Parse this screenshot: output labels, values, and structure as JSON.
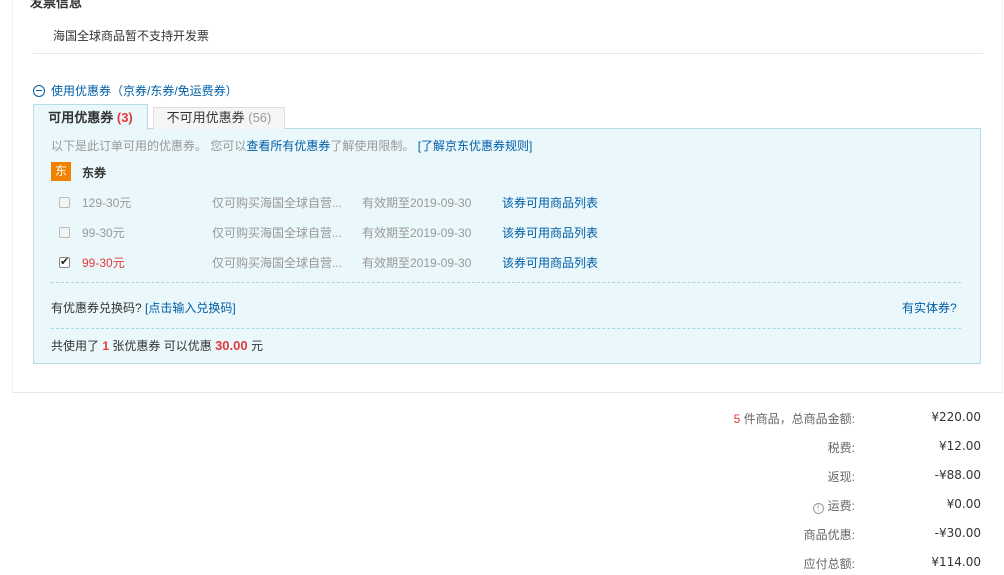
{
  "invoice": {
    "title": "发票信息",
    "note": "海国全球商品暂不支持开发票"
  },
  "coupon": {
    "toggle_label": "使用优惠券（京券/东券/免运费券）",
    "tabs": [
      {
        "label": "可用优惠券",
        "count": "(3)"
      },
      {
        "label": "不可用优惠券",
        "count": "(56)"
      }
    ],
    "intro_prefix": "以下是此订单可用的优惠券。 您可以",
    "intro_link": "查看所有优惠券",
    "intro_mid": "了解使用限制。",
    "intro_rules_link": "[了解京东优惠券规则]",
    "group_badge": "东",
    "group_label": "东券",
    "items": [
      {
        "amount": "129-30元",
        "desc": "仅可购买海国全球自营...",
        "expire": "有效期至2019-09-30",
        "goods_link": "该券可用商品列表",
        "checked": false
      },
      {
        "amount": "99-30元",
        "desc": "仅可购买海国全球自营...",
        "expire": "有效期至2019-09-30",
        "goods_link": "该券可用商品列表",
        "checked": false
      },
      {
        "amount": "99-30元",
        "desc": "仅可购买海国全球自营...",
        "expire": "有效期至2019-09-30",
        "goods_link": "该券可用商品列表",
        "checked": true
      }
    ],
    "redeem_prefix": "有优惠券兑换码?",
    "redeem_link": "[点击输入兑换码]",
    "physical_link": "有实体券?",
    "summary": {
      "prefix": "共使用了",
      "count": "1",
      "mid": "张优惠券 可以优惠",
      "amount": "30.00",
      "suffix": "元"
    }
  },
  "totals": {
    "goods_count": "5",
    "goods_label": "件商品，总商品金额:",
    "goods_value": "¥220.00",
    "tax_label": "税费:",
    "tax_value": "¥12.00",
    "rebate_label": "返现:",
    "rebate_value": "-¥88.00",
    "shipping_label": "运费:",
    "shipping_value": "¥0.00",
    "discount_label": "商品优惠:",
    "discount_value": "-¥30.00",
    "payable_label": "应付总额:",
    "payable_value": "¥114.00"
  }
}
